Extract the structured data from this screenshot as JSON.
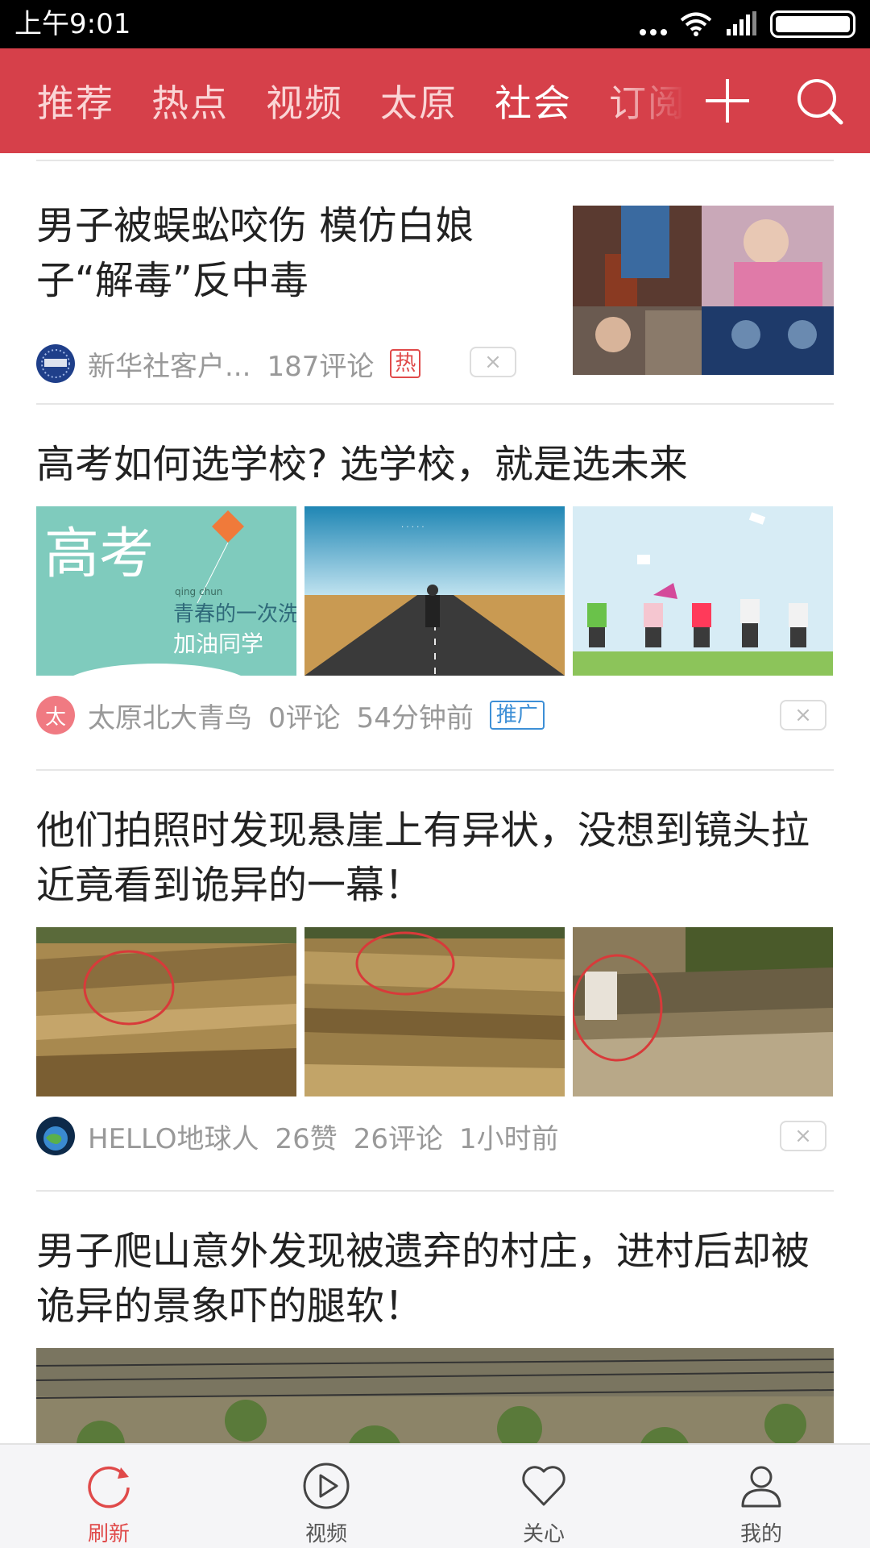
{
  "status_bar": {
    "time": "上午9:01"
  },
  "top_nav": {
    "tabs": [
      "推荐",
      "热点",
      "视频",
      "太原",
      "社会",
      "订阅"
    ],
    "active_tab": "社会"
  },
  "feed": {
    "items": [
      {
        "title": "男子被蜈蚣咬伤 模仿白娘子“解毒”反中毒",
        "source": "新华社客户...",
        "comments": "187评论",
        "tag": "热"
      },
      {
        "title": "高考如何选学校? 选学校，就是选未来",
        "source_avatar_text": "太",
        "source": "太原北大青鸟",
        "comments": "0评论",
        "time": "54分钟前",
        "tag": "推广",
        "image_texts": {
          "a": "高考",
          "b": "青春的一次洗礼",
          "c": "加油同学",
          "pinyin": "qing chun"
        }
      },
      {
        "title": "他们拍照时发现悬崖上有异状，没想到镜头拉近竟看到诡异的一幕！",
        "source": "HELLO地球人",
        "likes": "26赞",
        "comments": "26评论",
        "time": "1小时前"
      },
      {
        "title": "男子爬山意外发现被遗弃的村庄，进村后却被诡异的景象吓的腿软！"
      }
    ],
    "close_glyph": "×"
  },
  "bottom_nav": {
    "items": [
      {
        "label": "刷新",
        "icon": "refresh-icon"
      },
      {
        "label": "视频",
        "icon": "video-play-icon"
      },
      {
        "label": "关心",
        "icon": "heart-icon"
      },
      {
        "label": "我的",
        "icon": "profile-icon"
      }
    ],
    "active": "刷新"
  },
  "colors": {
    "brand_red": "#d6404a",
    "hot_tag": "#e04a4a",
    "promo_tag": "#3d8fd6"
  }
}
